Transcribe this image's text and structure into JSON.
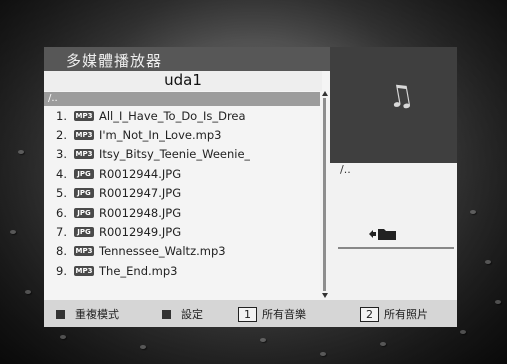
{
  "title": "多媒體播放器",
  "folder_name": "uda1",
  "parent_dir": "/..",
  "files": [
    {
      "num": "1.",
      "type": "MP3",
      "name": "All_I_Have_To_Do_Is_Drea"
    },
    {
      "num": "2.",
      "type": "MP3",
      "name": "I'm_Not_In_Love.mp3"
    },
    {
      "num": "3.",
      "type": "MP3",
      "name": "Itsy_Bitsy_Teenie_Weenie_"
    },
    {
      "num": "4.",
      "type": "JPG",
      "name": "R0012944.JPG"
    },
    {
      "num": "5.",
      "type": "JPG",
      "name": "R0012947.JPG"
    },
    {
      "num": "6.",
      "type": "JPG",
      "name": "R0012948.JPG"
    },
    {
      "num": "7.",
      "type": "JPG",
      "name": "R0012949.JPG"
    },
    {
      "num": "8.",
      "type": "MP3",
      "name": "Tennessee_Waltz.mp3"
    },
    {
      "num": "9.",
      "type": "MP3",
      "name": "The_End.mp3"
    }
  ],
  "preview": {
    "icon": "music-note-icon",
    "path": "/..",
    "folder_icon": "folder-up-icon"
  },
  "bottom_bar": {
    "repeat_label": "重複模式",
    "settings_label": "設定",
    "key1": "1",
    "all_music_label": "所有音樂",
    "key2": "2",
    "all_photos_label": "所有照片"
  }
}
